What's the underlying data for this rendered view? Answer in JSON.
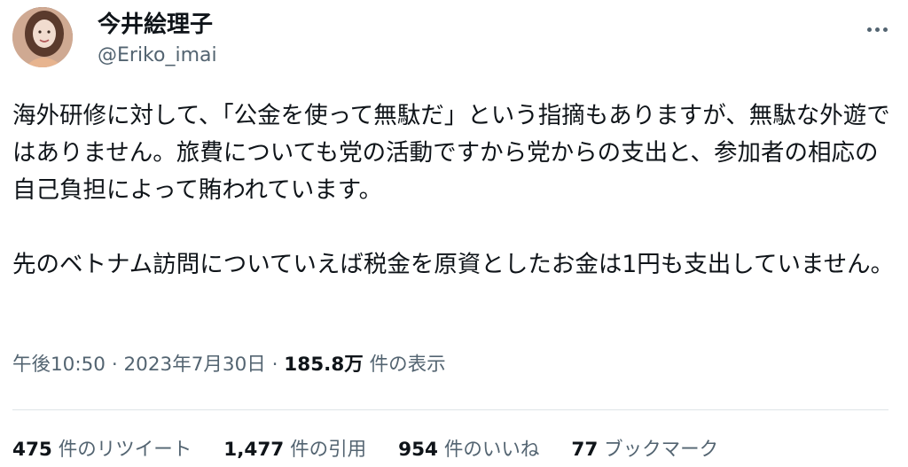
{
  "author": {
    "display_name": "今井絵理子",
    "handle": "@Eriko_imai",
    "avatar_icon": "avatar-photo"
  },
  "tweet": {
    "text": "海外研修に対して、「公金を使って無駄だ」という指摘もありますが、無駄な外遊ではありません。旅費についても党の活動ですから党からの支出と、参加者の相応の自己負担によって賄われています。\n\n先のベトナム訪問についていえば税金を原資としたお金は1円も支出していません。"
  },
  "meta": {
    "time": "午後10:50",
    "separator": "·",
    "date": "2023年7月30日",
    "views_count": "185.8万",
    "views_label": "件の表示"
  },
  "stats": [
    {
      "count": "475",
      "label": "件のリツイート"
    },
    {
      "count": "1,477",
      "label": "件の引用"
    },
    {
      "count": "954",
      "label": "件のいいね"
    },
    {
      "count": "77",
      "label": "ブックマーク"
    }
  ],
  "colors": {
    "text_primary": "#0f1419",
    "text_secondary": "#536471",
    "divider": "#dfe4e8"
  }
}
